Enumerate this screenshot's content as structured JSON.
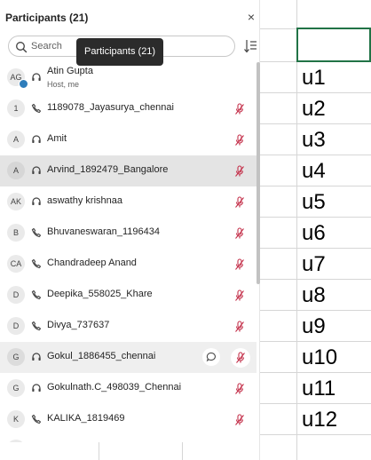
{
  "panel": {
    "title": "Participants (21)",
    "close_glyph": "×",
    "search_placeholder": "Search",
    "tooltip": "Participants (21)",
    "icons": {
      "close": "close-icon",
      "search": "search-icon",
      "sort": "sort-icon",
      "headset": "headset-icon",
      "phone": "phone-icon",
      "mic_muted": "mic-muted-icon",
      "chat": "chat-icon"
    },
    "colors": {
      "muted_mic": "#c4314b",
      "tooltip_bg": "#2b2b2b",
      "row_highlight": "#e4e4e4"
    }
  },
  "participants": [
    {
      "initials": "AG",
      "name": "Atin Gupta",
      "subtitle": "Host, me",
      "kind": "headset",
      "muted": false
    },
    {
      "initials": "1",
      "name": "1189078_Jayasurya_chennai",
      "kind": "phone",
      "muted": true
    },
    {
      "initials": "A",
      "name": "Amit",
      "kind": "headset",
      "muted": true
    },
    {
      "initials": "A",
      "name": "Arvind_1892479_Bangalore",
      "kind": "headset",
      "muted": true
    },
    {
      "initials": "AK",
      "name": "aswathy krishnaa",
      "kind": "headset",
      "muted": true
    },
    {
      "initials": "B",
      "name": "Bhuvaneswaran_1196434",
      "kind": "phone",
      "muted": true
    },
    {
      "initials": "CA",
      "name": "Chandradeep Anand",
      "kind": "phone",
      "muted": true
    },
    {
      "initials": "D",
      "name": "Deepika_558025_Khare",
      "kind": "phone",
      "muted": true
    },
    {
      "initials": "D",
      "name": "Divya_737637",
      "kind": "phone",
      "muted": true
    },
    {
      "initials": "G",
      "name": "Gokul_1886455_chennai",
      "kind": "headset",
      "muted": true
    },
    {
      "initials": "G",
      "name": "Gokulnath.C_498039_Chennai",
      "kind": "headset",
      "muted": true
    },
    {
      "initials": "K",
      "name": "KALIKA_1819469",
      "kind": "phone",
      "muted": true
    }
  ],
  "sheet": {
    "cells": [
      "u1",
      "u2",
      "u3",
      "u4",
      "u5",
      "u6",
      "u7",
      "u8",
      "u9",
      "u10",
      "u11",
      "u12"
    ]
  }
}
